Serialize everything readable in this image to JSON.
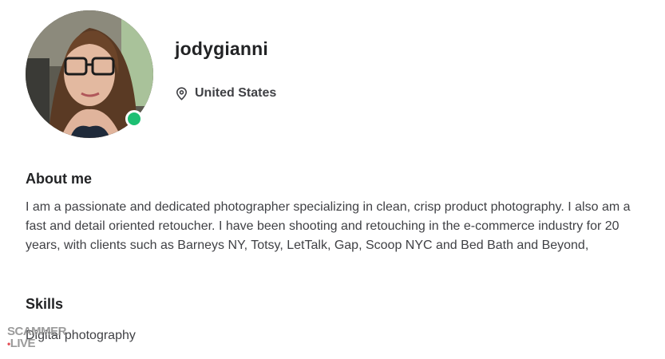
{
  "profile": {
    "username": "jodygianni",
    "location": "United States",
    "status": "online"
  },
  "about": {
    "title": "About me",
    "text": "I am a passionate and dedicated photographer specializing in clean, crisp product photography. I also am a fast and detail oriented retoucher. I have been shooting and retouching in the e-commerce industry for 20 years, with clients such as Barneys NY, Totsy, LetTalk, Gap, Scoop NYC and Bed Bath and Beyond,"
  },
  "skills": {
    "title": "Skills",
    "items": [
      "Digital photography"
    ]
  },
  "watermark": {
    "line1": "SCAMMER",
    "line2": "LIVE"
  },
  "colors": {
    "online": "#1dbf73",
    "heading": "#222325",
    "body": "#404145"
  },
  "icons": {
    "location": "map-pin-icon"
  }
}
